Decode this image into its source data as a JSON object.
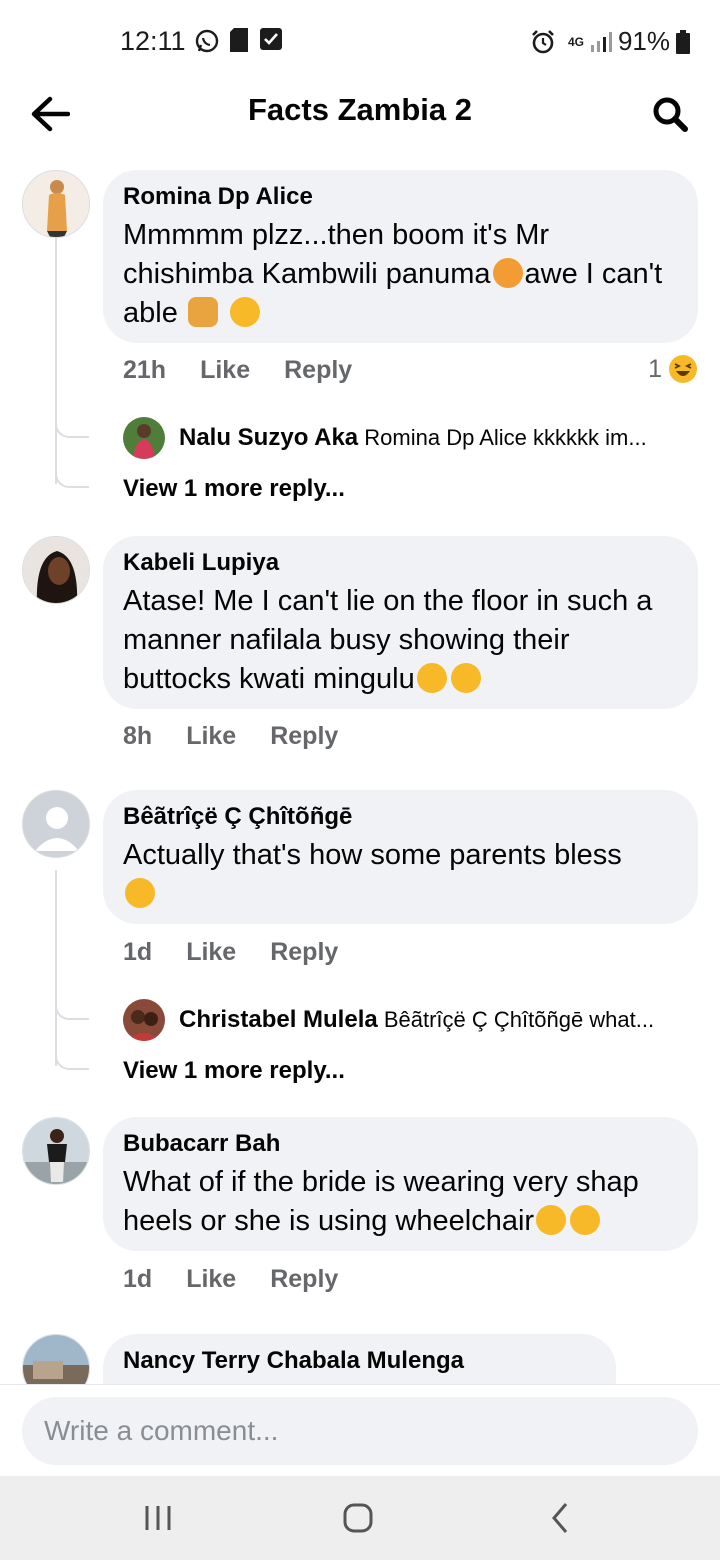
{
  "status_bar": {
    "time": "12:11",
    "network": "4G",
    "battery": "91%"
  },
  "header": {
    "title": "Facts Zambia 2"
  },
  "comments": [
    {
      "author": "Romina Dp Alice",
      "text": "Mmmmm plzz...then boom it's Mr chishimba Kambwili panuma",
      "text_after_emoji": "awe I can't able",
      "time": "21h",
      "like_label": "Like",
      "reply_label": "Reply",
      "reaction_count": "1",
      "reply": {
        "author": "Nalu Suzyo Aka",
        "text": "Romina Dp Alice kkkkkk im..."
      },
      "more_replies": "View 1 more reply..."
    },
    {
      "author": "Kabeli Lupiya",
      "text": "Atase! Me I can't lie on the floor in such a manner nafilala busy showing their buttocks kwati mingulu",
      "time": "8h",
      "like_label": "Like",
      "reply_label": "Reply"
    },
    {
      "author": "Bêãtrîçë Ç Çhîtõñgē",
      "text": "Actually that's how some parents bless",
      "time": "1d",
      "like_label": "Like",
      "reply_label": "Reply",
      "reply": {
        "author": "Christabel Mulela",
        "text": "Bêãtrîçë Ç Çhîtõñgē what..."
      },
      "more_replies": "View 1 more reply..."
    },
    {
      "author": "Bubacarr Bah",
      "text": "What of if the bride is wearing very shap heels or she is using wheelchair",
      "time": "1d",
      "like_label": "Like",
      "reply_label": "Reply"
    },
    {
      "author": "Nancy Terry Chabala Mulenga"
    }
  ],
  "composer": {
    "placeholder": "Write a comment..."
  },
  "colors": {
    "bubble": "#f0f2f5",
    "secondary_text": "#65676b",
    "emoji_yellow": "#f7b928"
  },
  "icons": {
    "back": "arrow-left-icon",
    "search": "search-icon",
    "nav_recents": "recents-icon",
    "nav_home": "home-icon",
    "nav_back": "nav-back-icon"
  }
}
